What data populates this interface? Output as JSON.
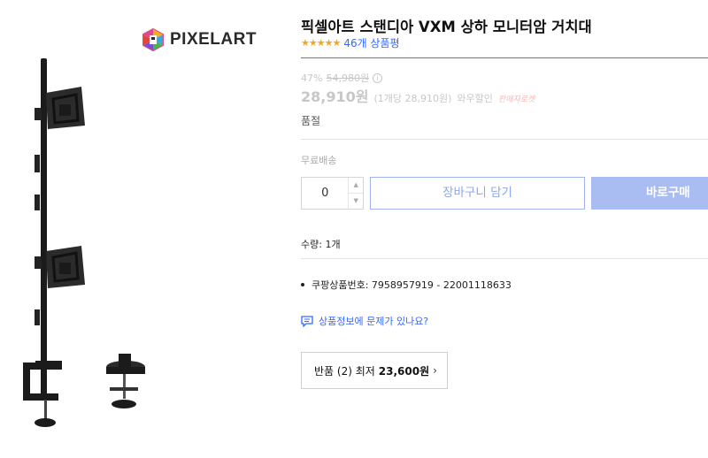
{
  "brand": {
    "name": "PIXELART",
    "logo_icon": "pixelart-logo-icon"
  },
  "product": {
    "title": "픽셀아트 스탠디아 VXM 상하 모니터암 거치대",
    "stars": "★★★★★",
    "review_count": "46개 상품평",
    "discount_rate": "47%",
    "original_price": "54,980원",
    "price": "28,910원",
    "unit_price": "(1개당 28,910원)",
    "wow_label": "와우할인",
    "rocket_label": "판매자로켓",
    "stock_status": "품절"
  },
  "purchase": {
    "shipping": "무료배송",
    "quantity": "0",
    "qty_up": "▲",
    "qty_down": "▼",
    "cart_label": "장바구니 담기",
    "buy_label": "바로구매"
  },
  "details": {
    "quantity_text": "수량: 1개",
    "product_code": "쿠팡상품번호: 7958957919 - 22001118633",
    "report_link": "상품정보에 문제가 있나요?"
  },
  "returns": {
    "label": "반품 (2) 최저",
    "price": "23,600원",
    "chevron": "›"
  },
  "colors": {
    "accent_blue": "#346aff",
    "star": "#f5a623",
    "buy_button": "#aabdf3"
  }
}
